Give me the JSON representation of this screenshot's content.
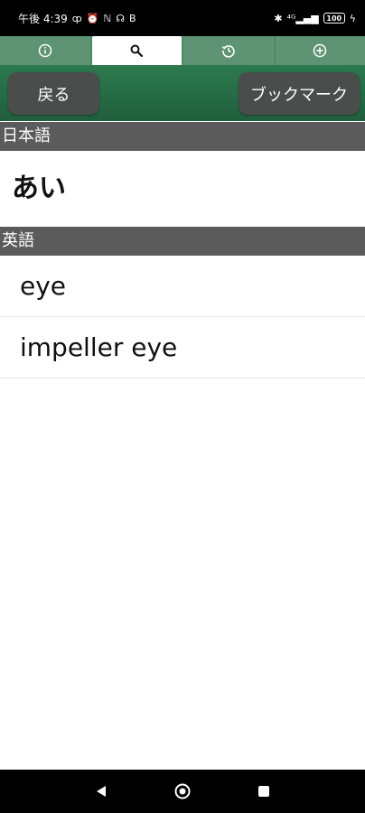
{
  "status_bar": {
    "time": "午後 4:39",
    "left_icons": [
      "ȹ",
      "⏰",
      "ℕ",
      "☊",
      "B"
    ],
    "right_icons": [
      "✱",
      "⁴ᴳ▂▄▆"
    ],
    "battery": "100",
    "charging_icon": "ϟ"
  },
  "tabs": [
    {
      "name": "info",
      "icon": "info-icon",
      "active": false
    },
    {
      "name": "search",
      "icon": "search-icon",
      "active": true
    },
    {
      "name": "history",
      "icon": "history-icon",
      "active": false
    },
    {
      "name": "add",
      "icon": "add-icon",
      "active": false
    }
  ],
  "toolbar": {
    "back_label": "戻る",
    "bookmark_label": "ブックマーク"
  },
  "japanese_section": {
    "header": "日本語",
    "word": "あい"
  },
  "english_section": {
    "header": "英語",
    "results": [
      "eye",
      "impeller eye"
    ]
  },
  "colors": {
    "tab_bar": "#4e8a64",
    "toolbar": "#2d7a4f",
    "section_header": "#5b5b5b",
    "button": "#4a4d4c"
  }
}
